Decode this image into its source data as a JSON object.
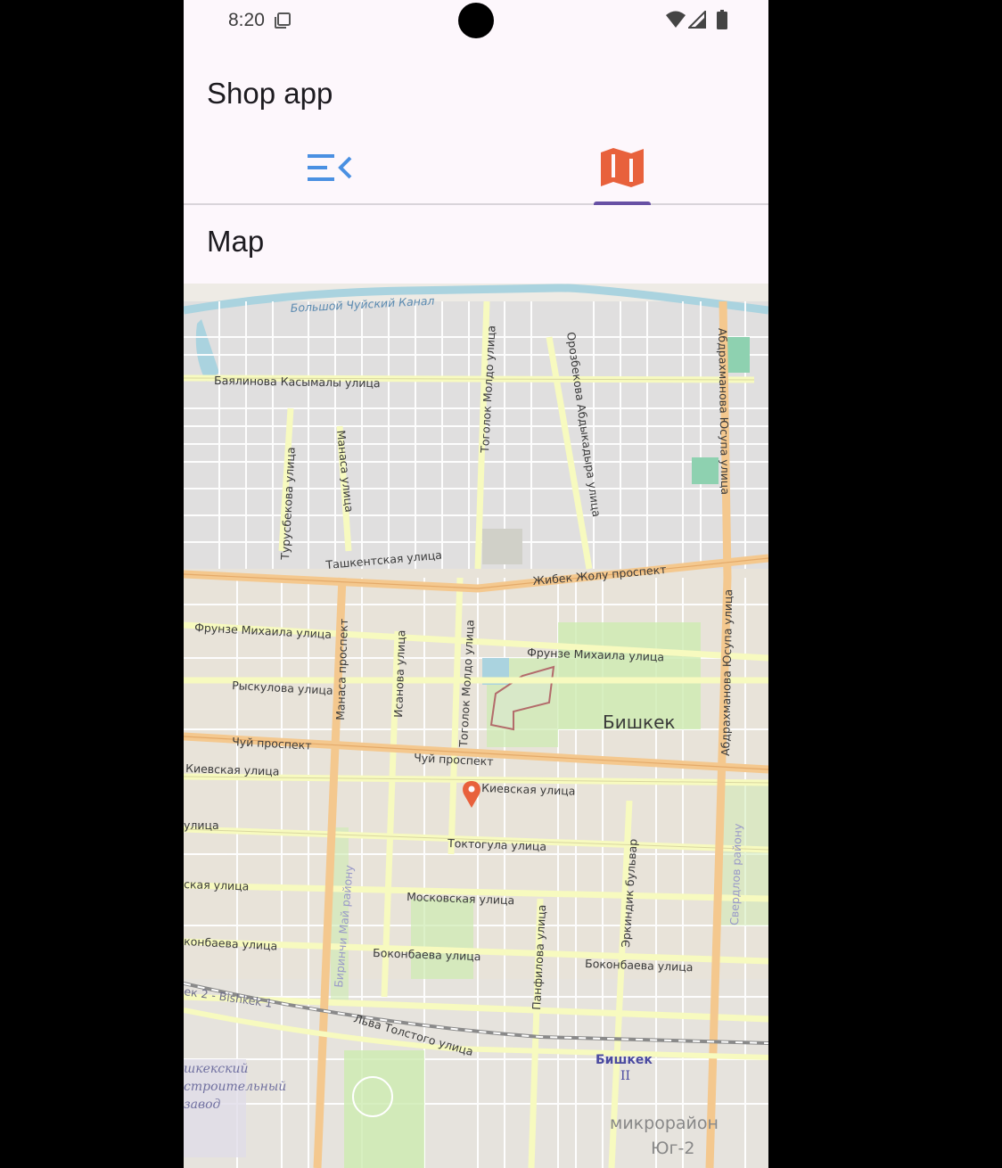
{
  "status_bar": {
    "time": "8:20"
  },
  "app_bar": {
    "title": "Shop app"
  },
  "tabs": [
    {
      "name": "list",
      "icon": "menu-open-icon",
      "color": "#4a90e2",
      "selected": false
    },
    {
      "name": "map",
      "icon": "map-icon",
      "color": "#e8613c",
      "selected": true
    }
  ],
  "section": {
    "title": "Map"
  },
  "map": {
    "marker_color": "#e8613c",
    "labels": {
      "canal": "Большой Чуйский Канал",
      "baialinova": "Баялинова Касымалы улица",
      "togolok_north": "Тоголок Молдо улица",
      "orozbekova": "Орозбекова Абдыкадыра улица",
      "abdrakhmanova_north": "Абдрахманова Юсупа улица",
      "turusbekova": "Турусбекова улица",
      "manasa_st": "Манаса улица",
      "tashkentskaya": "Ташкентская улица",
      "zhibek_zholu": "Жибек Жолу проспект",
      "frunze_west": "Фрунзе Михаила улица",
      "manasa_prospekt": "Манаса проспект",
      "isanova": "Исанова улица",
      "togolok_south": "Тоголок Молдо улица",
      "frunze_east": "Фрунзе Михаила улица",
      "abdrakhmanova_south": "Абдрахманова Юсупа улица",
      "ryskulova": "Рыскулова улица",
      "city": "Бишкек",
      "chui_west": "Чуй проспект",
      "chui_center": "Чуй проспект",
      "kievskaya_west": "Киевская улица",
      "kievskaya_center": "Киевская улица",
      "ulica": "улица",
      "toktogula": "Токтогула улица",
      "sverdlov": "Свердлов району",
      "erkindik": "Эркиндик бульвар",
      "biyrinchi_may": "Биринчи Май району",
      "moskovskaya_west": "ская улица",
      "moskovskaya": "Московская улица",
      "panfilova": "Панфилова улица",
      "bokonbaeva_west": "конбаева улица",
      "bokonbaeva_center": "Боконбаева улица",
      "bokonbaeva_east": "Боконбаева улица",
      "bishkek1": "ек 2 - Bishkek 1",
      "tolstogo": "Льва Толстого улица",
      "station": "Бишкек",
      "station_num": "II",
      "factory1": "шкекский",
      "factory2": "строительный",
      "factory3": "завод",
      "district1": "микрорайон",
      "district2": "Юг-2"
    }
  }
}
